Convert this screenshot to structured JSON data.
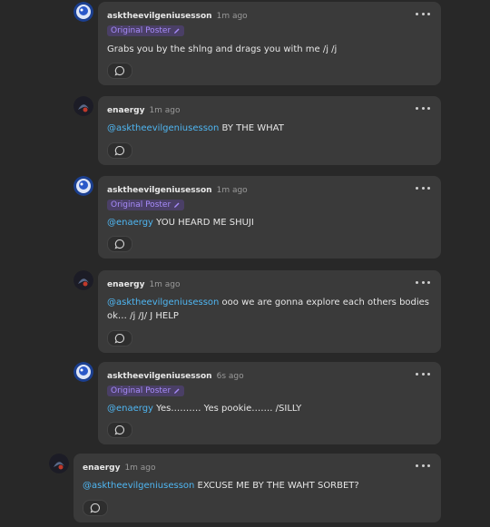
{
  "badge_label": "Original Poster",
  "comments": [
    {
      "user": "asktheevilgeniusesson",
      "time": "1m ago",
      "op": true,
      "mention": "",
      "text": "Grabs you by the shlng and drags you with me /j /j"
    },
    {
      "user": "enaergy",
      "time": "1m ago",
      "op": false,
      "mention": "@asktheevilgeniusesson",
      "text": " BY THE WHAT"
    },
    {
      "user": "asktheevilgeniusesson",
      "time": "1m ago",
      "op": true,
      "mention": "@enaergy",
      "text": " YOU HEARD ME SHUJI"
    },
    {
      "user": "enaergy",
      "time": "1m ago",
      "op": false,
      "mention": "@asktheevilgeniusesson",
      "text": " ooo we are gonna explore each others bodies ok… /j /J/ J HELP"
    },
    {
      "user": "asktheevilgeniusesson",
      "time": "6s ago",
      "op": true,
      "mention": "@enaergy",
      "text": " Yes………. Yes pookie……. /SILLY"
    },
    {
      "user": "enaergy",
      "time": "1m ago",
      "op": false,
      "mention": "@asktheevilgeniusesson",
      "text": " EXCUSE ME BY THE WAHT SORBET?"
    }
  ],
  "icons": {
    "more": "more-horizontal-icon",
    "reply": "reply-bubble-icon",
    "edit": "pencil-icon"
  },
  "colors": {
    "background": "#282828",
    "card": "#3a3a3a",
    "mention": "#4fb6f2",
    "badge_text": "#a78bfa",
    "badge_bg": "#4a3f66"
  }
}
